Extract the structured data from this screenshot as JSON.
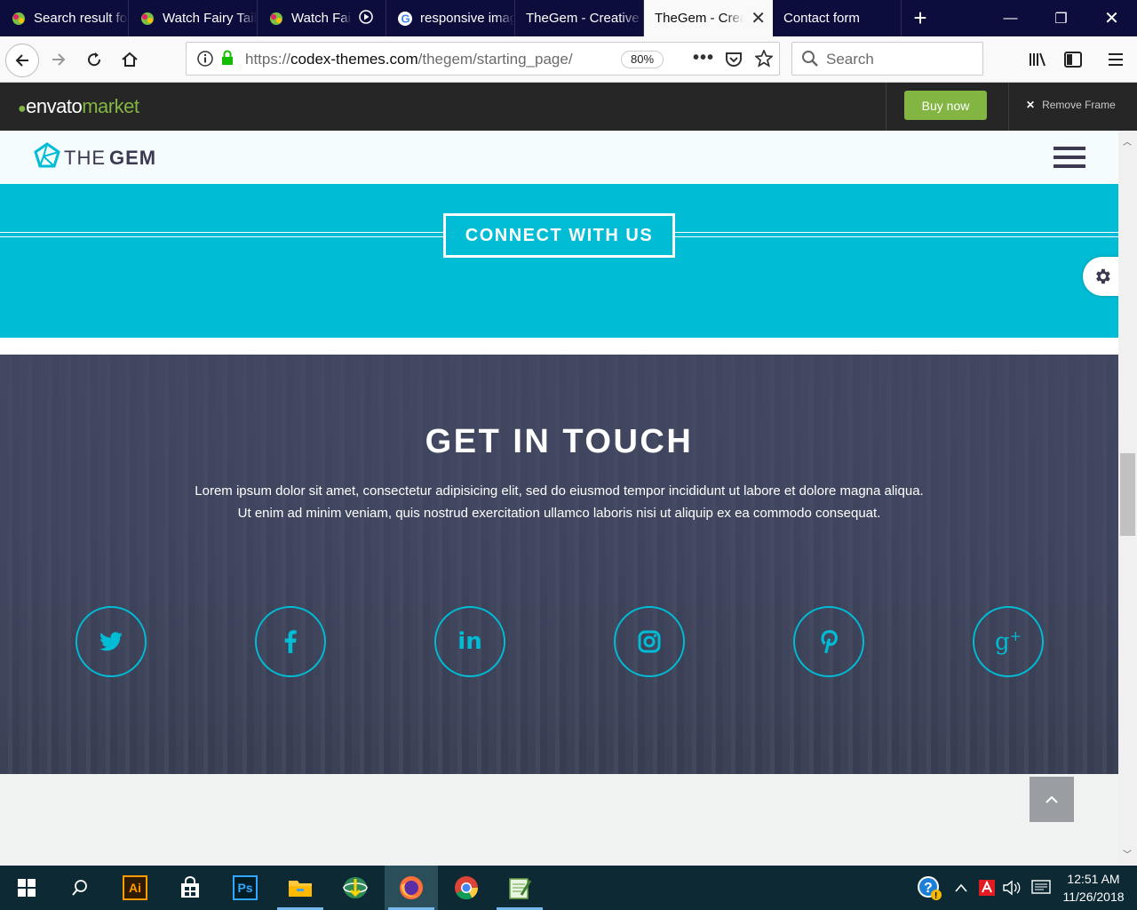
{
  "browser": {
    "tabs": [
      {
        "label": "Search result for",
        "icon": "fairy-tail-icon"
      },
      {
        "label": "Watch Fairy Tail",
        "icon": "fairy-tail-icon"
      },
      {
        "label": "Watch Fairy Tail",
        "icon": "fairy-tail-icon",
        "playing": true
      },
      {
        "label": "responsive images",
        "icon": "google-icon"
      },
      {
        "label": "TheGem - Creative",
        "icon": "none"
      },
      {
        "label": "TheGem - Creative",
        "icon": "none",
        "active": true
      },
      {
        "label": "Contact form",
        "icon": "none"
      }
    ],
    "url_prefix": "https://",
    "url_main": "codex-themes.com",
    "url_path": "/thegem/starting_page/",
    "zoom": "80%",
    "search_placeholder": "Search"
  },
  "envato": {
    "logo_envato": "envato",
    "logo_market": "market",
    "buy_now": "Buy now",
    "remove_frame": "Remove Frame"
  },
  "site": {
    "logo_light": "THE",
    "logo_bold": "GEM",
    "connect_label": "CONNECT WITH US",
    "contact_title": "GET IN TOUCH",
    "contact_line1": "Lorem ipsum dolor sit amet, consectetur adipisicing elit, sed do eiusmod tempor incididunt ut labore et dolore magna aliqua.",
    "contact_line2": "Ut enim ad minim veniam, quis nostrud exercitation ullamco laboris nisi ut aliquip ex ea commodo consequat.",
    "socials": [
      "twitter",
      "facebook",
      "linkedin",
      "instagram",
      "pinterest",
      "google-plus"
    ],
    "accent": "#00bcd4"
  },
  "taskbar": {
    "time": "12:51 AM",
    "date": "11/26/2018"
  }
}
